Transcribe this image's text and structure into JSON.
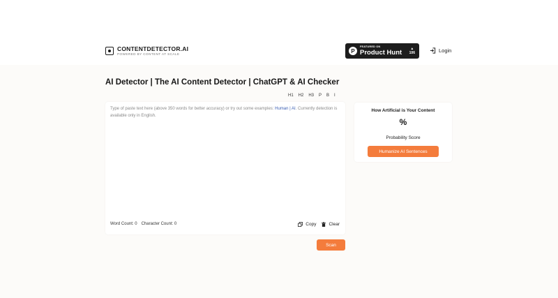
{
  "header": {
    "logo_name": "CONTENTDETECTOR.AI",
    "logo_tagline": "POWERED BY CONTENT AT SCALE",
    "product_hunt": {
      "featured": "FEATURED ON",
      "name": "Product Hunt",
      "badge_letter": "P",
      "arrow": "▲",
      "votes": "106"
    },
    "login_label": "Login"
  },
  "page": {
    "title": "AI Detector | The AI Content Detector | ChatGPT & AI Checker"
  },
  "format_bar": [
    "H1",
    "H2",
    "H3",
    "P",
    "B",
    "I"
  ],
  "editor": {
    "placeholder_before": "Type of paste text here (above 350 words for better accuracy) or try out some examples: ",
    "example_human": "Human",
    "separator": " | ",
    "example_ai": "AI",
    "placeholder_after": ". Currently detection is available only in English.",
    "word_count_label": "Word Count: 0",
    "char_count_label": "Character Count: 0",
    "copy_label": "Copy",
    "clear_label": "Clear"
  },
  "scan_label": "Scan",
  "result": {
    "title": "How Artificial is Your Content",
    "percent": "%",
    "score_label": "Probability Score",
    "humanize_label": "Humanize AI Sentences"
  },
  "colors": {
    "accent": "#f47c3c",
    "link": "#3b5fb3",
    "badge_bg": "#1d1d1d"
  }
}
